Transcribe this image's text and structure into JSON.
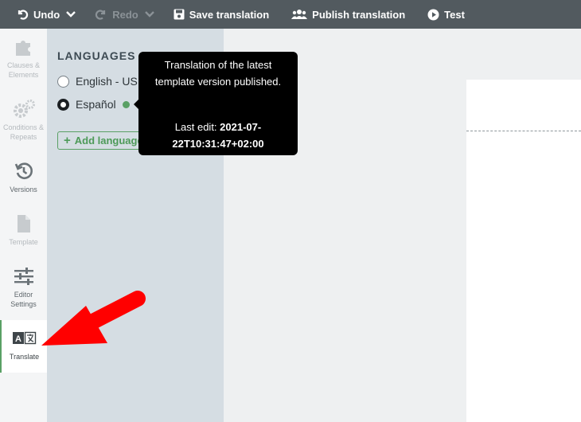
{
  "toolbar": {
    "undo_label": "Undo",
    "redo_label": "Redo",
    "save_label": "Save translation",
    "publish_label": "Publish translation",
    "test_label": "Test"
  },
  "rail": {
    "items": [
      {
        "label": "Clauses & Elements",
        "icon": "puzzle-icon",
        "state": "disabled"
      },
      {
        "label": "Conditions & Repeats",
        "icon": "gears-icon",
        "state": "disabled"
      },
      {
        "label": "Versions",
        "icon": "history-icon",
        "state": "enabled"
      },
      {
        "label": "Template",
        "icon": "file-icon",
        "state": "disabled"
      },
      {
        "label": "Editor Settings",
        "icon": "sliders-icon",
        "state": "enabled"
      },
      {
        "label": "Translate",
        "icon": "translate-icon",
        "state": "active"
      }
    ]
  },
  "languages": {
    "title": "LANGUAGES",
    "options": [
      {
        "label": "English - US",
        "selected": false
      },
      {
        "label": "Español",
        "selected": true,
        "status_color": "#5aa065"
      }
    ],
    "add_label": "Add language"
  },
  "tooltip": {
    "line1": "Translation of the latest",
    "line2": "template version published.",
    "last_edit_label": "Last edit:",
    "last_edit_value": "2021-07-22T10:31:47+02:00"
  },
  "colors": {
    "toolbar_bg": "#525a5f",
    "accent_green": "#5aa065",
    "panel_bg": "#d5dde3",
    "annotation_red": "#ff0000"
  }
}
